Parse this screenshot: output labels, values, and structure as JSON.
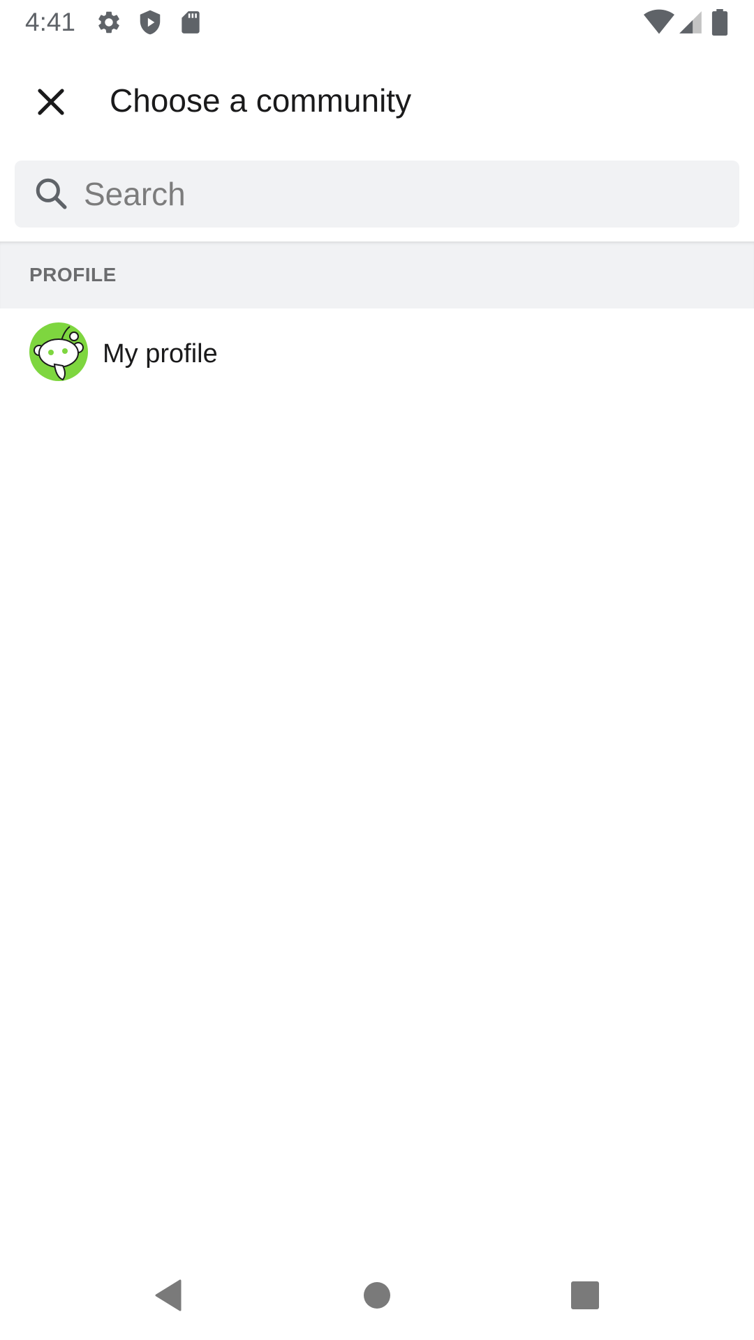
{
  "status_bar": {
    "time": "4:41",
    "left_icons": [
      "gear-icon",
      "shield-play-icon",
      "sd-card-icon"
    ],
    "right_icons": [
      "wifi-icon",
      "cell-signal-icon",
      "battery-icon"
    ]
  },
  "app_bar": {
    "title": "Choose a community",
    "close_icon": "close-icon"
  },
  "search": {
    "placeholder": "Search",
    "value": "",
    "icon": "search-icon"
  },
  "sections": [
    {
      "label": "PROFILE",
      "items": [
        {
          "label": "My profile",
          "avatar": "snoo-avatar",
          "avatar_color": "#7ed63f"
        }
      ]
    }
  ],
  "nav_bar": {
    "buttons": [
      "back-triangle-icon",
      "home-circle-icon",
      "recents-square-icon"
    ]
  },
  "colors": {
    "background": "#ffffff",
    "search_bg": "#f1f2f4",
    "section_bg": "#f1f2f4",
    "text_primary": "#1a1a1b",
    "text_secondary": "#6b6c6e",
    "status_icon": "#5f6368",
    "avatar_green": "#7ed63f"
  }
}
